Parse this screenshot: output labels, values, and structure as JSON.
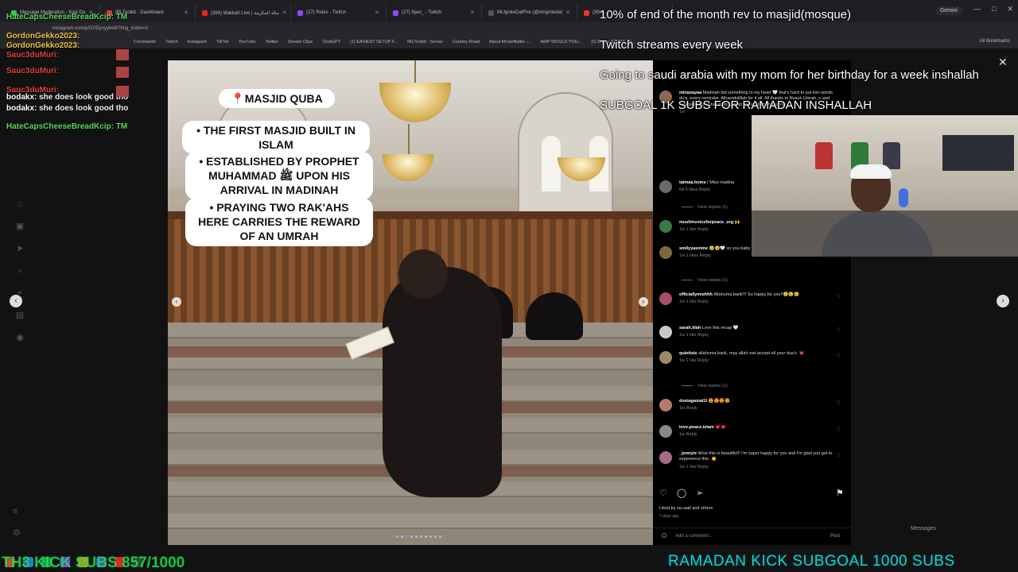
{
  "browser": {
    "tabs": [
      {
        "label": "Message Moderation - Kick Da",
        "color": "#35c85a"
      },
      {
        "label": "IRLToolkit - Dashboard",
        "color": "#d83a3a"
      },
      {
        "label": "(394) Makkah Live | مكة المكرمة",
        "color": "#e22"
      },
      {
        "label": "(27) Roles - Twitch",
        "color": "#9146ff"
      },
      {
        "label": "(27) 9javi_ - Twitch",
        "color": "#9146ff"
      },
      {
        "label": "MrJgniteDatFire (@mrignitedat",
        "color": "#555"
      },
      {
        "label": "(394) ..."
      }
    ],
    "gemini_label": "Gemini",
    "window_controls": [
      "—",
      "□",
      "✕"
    ],
    "address": "instagram.com/p/DVDynyyke8/?img_index=3",
    "bookmarks": [
      "Commands",
      "Twitch",
      "Instagram",
      "TikTok",
      "YouTube",
      "Twitter",
      "Stream Clips",
      "ChatGPT",
      "(1) EASIEST SETUP F...",
      "IRLToolkit - Server",
      "Country Road",
      "About MovieBattle -...",
      "AMP WOULD YOU...",
      "(5) Bruno STOPS Th..."
    ],
    "all_bookmarks": "All Bookmarks"
  },
  "overlay": {
    "lines": [
      "10% of end of the month rev to masjid(mosque)",
      "Twitch streams every week",
      "Going to saudi arabia with my mom for her birthday for a week inshallah",
      "SUBGOAL 1K SUBS FOR RAMADAN INSHALLAH"
    ],
    "bottom_right": "RAMADAN KICK SUBGOAL 1000 SUBS",
    "bottom_left": "TH3 KICK SUBS 857/1000"
  },
  "chat": [
    {
      "user": "HateCapsCheeseBreadKcip:",
      "msg": "TM",
      "color": "#5bd85b"
    },
    {
      "user": "GordonGekko2023:",
      "msg": "",
      "color": "#f0c040"
    },
    {
      "user": "GordonGekko2023:",
      "msg": "",
      "color": "#f0c040"
    },
    {
      "user": "Sauc3duMuri:",
      "msg": "",
      "color": "#e04040"
    },
    {
      "user": "Sauc3duMuri:",
      "msg": "",
      "color": "#e04040"
    },
    {
      "user": "Sauc3duMuri:",
      "msg": "",
      "color": "#e04040"
    },
    {
      "user": "bodakx:",
      "msg": "she does look good tho",
      "color": "#ffffff"
    },
    {
      "user": "bodakx:",
      "msg": "she does look good tho",
      "color": "#ffffff"
    },
    {
      "user": "HateCapsCheeseBreadKcip:",
      "msg": "TM",
      "color": "#5bd85b"
    }
  ],
  "post": {
    "caption_title": "📍MASJID QUBA",
    "caption_points": [
      "• THE FIRST MASJID BUILT IN ISLAM",
      "• ESTABLISHED BY PROPHET MUHAMMAD ﷺ UPON HIS ARRIVAL IN MADINAH",
      "• PRAYING TWO RAK'AHS HERE CARRIES THE REWARD OF AN UMRAH"
    ],
    "comments": [
      {
        "user": "minaxayaa",
        "text": "Madinah did something to my heart 🤍 that's hard to put into words. du'a, every reminder. Alhamdulillah for it all. All thanks to Nusuk Umrah, e and seamless from start to fin Umrah insha'Allah : https://un",
        "meta": "1w"
      },
      {
        "user": "taimaa.homs",
        "text": "I Miss madina",
        "meta": "6d   5 likes   Reply"
      },
      {
        "user": "muslimvoiceforpeace_org",
        "text": "🙌",
        "meta": "1w   1 like   Reply"
      },
      {
        "user": "smilyyasmine",
        "text": "🥹🥹🤍 so you baby girl 🥹🤍",
        "meta": "1w   2 likes   Reply"
      },
      {
        "user": "officiallymishhh",
        "text": "Allahuma barik!!! So happy for you!!🥹🥹🥹",
        "meta": "1w   1 like   Reply"
      },
      {
        "user": "sarah.lilah",
        "text": "Love this recap 🤍",
        "meta": "1w   1 like   Reply"
      },
      {
        "user": "quiettsis",
        "text": "allahuma barik, may allah swt accept all your dua's. 💗",
        "meta": "1w   1 like   Reply"
      },
      {
        "user": "doniagamal1l",
        "text": "😍😍😍😍",
        "meta": "1w   Reply"
      },
      {
        "user": "love.peace.islam",
        "text": "💗💗",
        "meta": "1w   Reply"
      },
      {
        "user": "_jennyle",
        "text": "Wow this is beautiful!! I'm super happy for you and I'm glad you got to experience this. 👏",
        "meta": "1w   1 like   Reply"
      }
    ],
    "view_replies": "View replies (1)",
    "liked_by": "Liked by sa.raall and others",
    "ago": "7 days ago",
    "add_comment_placeholder": "Add a comment...",
    "post_label": "Post",
    "messages_label": "Messages"
  },
  "colors": {
    "accent": "#10d4c4",
    "chat_green": "#5bd85b",
    "link": "#7aa6d8"
  }
}
